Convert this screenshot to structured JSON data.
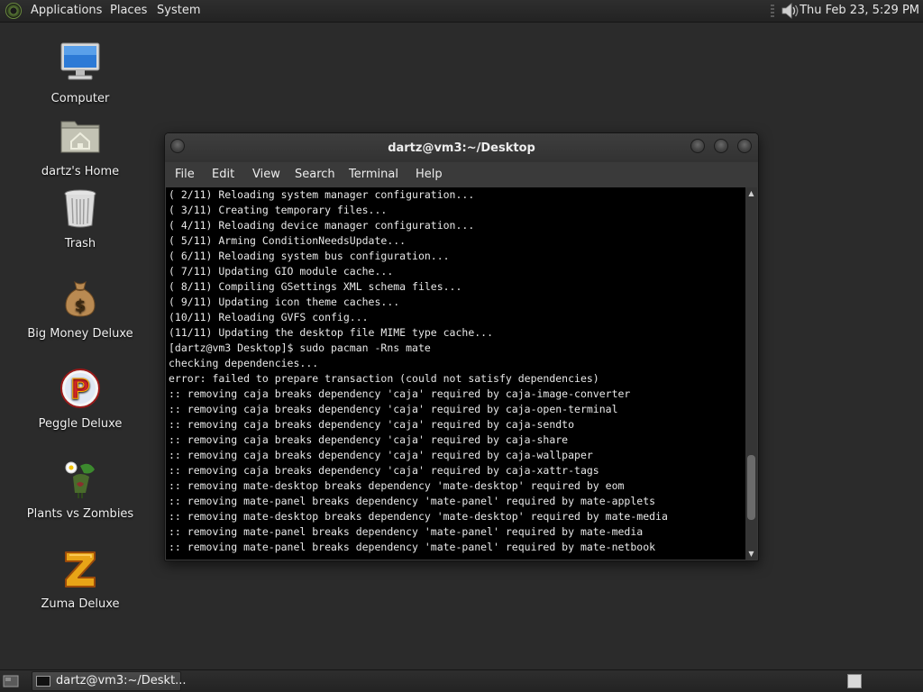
{
  "top_panel": {
    "menus": {
      "applications": "Applications",
      "places": "Places",
      "system": "System"
    },
    "clock": "Thu Feb 23,  5:29 PM"
  },
  "desktop_icons": [
    {
      "label": "Computer",
      "icon": "computer-icon"
    },
    {
      "label": "dartz's Home",
      "icon": "home-folder-icon"
    },
    {
      "label": "Trash",
      "icon": "trash-icon"
    },
    {
      "label": "Big Money Deluxe",
      "icon": "money-bag-icon"
    },
    {
      "label": "Peggle Deluxe",
      "icon": "peggle-icon"
    },
    {
      "label": "Plants vs Zombies",
      "icon": "plants-vs-zombies-icon"
    },
    {
      "label": "Zuma Deluxe",
      "icon": "zuma-icon"
    }
  ],
  "terminal": {
    "title": "dartz@vm3:~/Desktop",
    "menu": {
      "file": "File",
      "edit": "Edit",
      "view": "View",
      "search": "Search",
      "terminal": "Terminal",
      "help": "Help"
    },
    "lines": [
      "( 2/11) Reloading system manager configuration...",
      "( 3/11) Creating temporary files...",
      "( 4/11) Reloading device manager configuration...",
      "( 5/11) Arming ConditionNeedsUpdate...",
      "( 6/11) Reloading system bus configuration...",
      "( 7/11) Updating GIO module cache...",
      "( 8/11) Compiling GSettings XML schema files...",
      "( 9/11) Updating icon theme caches...",
      "(10/11) Reloading GVFS config...",
      "(11/11) Updating the desktop file MIME type cache...",
      "[dartz@vm3 Desktop]$ sudo pacman -Rns mate",
      "checking dependencies...",
      "error: failed to prepare transaction (could not satisfy dependencies)",
      ":: removing caja breaks dependency 'caja' required by caja-image-converter",
      ":: removing caja breaks dependency 'caja' required by caja-open-terminal",
      ":: removing caja breaks dependency 'caja' required by caja-sendto",
      ":: removing caja breaks dependency 'caja' required by caja-share",
      ":: removing caja breaks dependency 'caja' required by caja-wallpaper",
      ":: removing caja breaks dependency 'caja' required by caja-xattr-tags",
      ":: removing mate-desktop breaks dependency 'mate-desktop' required by eom",
      ":: removing mate-panel breaks dependency 'mate-panel' required by mate-applets",
      ":: removing mate-desktop breaks dependency 'mate-desktop' required by mate-media",
      ":: removing mate-panel breaks dependency 'mate-panel' required by mate-media",
      ":: removing mate-panel breaks dependency 'mate-panel' required by mate-netbook"
    ],
    "scroll_position": 0.9
  },
  "bottom_panel": {
    "task_label": "dartz@vm3:~/Deskt..."
  }
}
